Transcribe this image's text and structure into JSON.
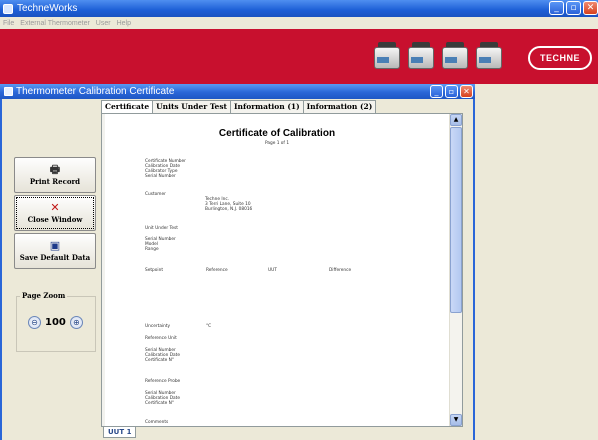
{
  "app": {
    "title": "TechneWorks",
    "menu": [
      "File",
      "External Thermometer",
      "User",
      "Help"
    ],
    "window_buttons": [
      "_",
      "▫",
      "✕"
    ]
  },
  "banner": {
    "logo_text": "TECHNE",
    "background": "#c8102e"
  },
  "child_window": {
    "title": "Thermometer Calibration Certificate",
    "buttons": [
      "_",
      "▫",
      "✕"
    ]
  },
  "tabs": [
    {
      "label": "Certificate",
      "active": true
    },
    {
      "label": "Units Under Test",
      "active": false
    },
    {
      "label": "Information (1)",
      "active": false
    },
    {
      "label": "Information (2)",
      "active": false
    }
  ],
  "left_panel": {
    "print_label": "Print Record",
    "close_label": "Close Window",
    "save_label": "Save Default Data",
    "zoom_label": "Page Zoom",
    "zoom_value": "100",
    "zoom_out_glyph": "⊖",
    "zoom_in_glyph": "⊕"
  },
  "document": {
    "title": "Certificate of Calibration",
    "page_info": "Page 1 of 1",
    "cert_fields": [
      "Certificate Number",
      "Calibration Date",
      "Calibrator Type",
      "Serial Number"
    ],
    "customer_label": "Customer",
    "customer_lines": [
      "Techne Inc.",
      "3 Terri Lane, Suite 10",
      "Burlington, N.J. 08016"
    ],
    "uut_label": "Unit Under Test",
    "uut_fields": [
      "Serial Number",
      "Model",
      "Range"
    ],
    "table_headers": [
      "Setpoint",
      "Reference",
      "UUT",
      "Difference"
    ],
    "uncertainty_label": "Uncertainty",
    "uncertainty_unit": "°C",
    "ref_unit_label": "Reference Unit",
    "ref_unit_fields": [
      "Serial Number",
      "Calibration Date",
      "Certificate N°"
    ],
    "ref_probe_label": "Reference Probe",
    "ref_probe_fields": [
      "Serial Number",
      "Calibration Date",
      "Certificate N°"
    ],
    "comments_label": "Comments"
  },
  "bottom_tab": {
    "label": "UUT 1"
  }
}
